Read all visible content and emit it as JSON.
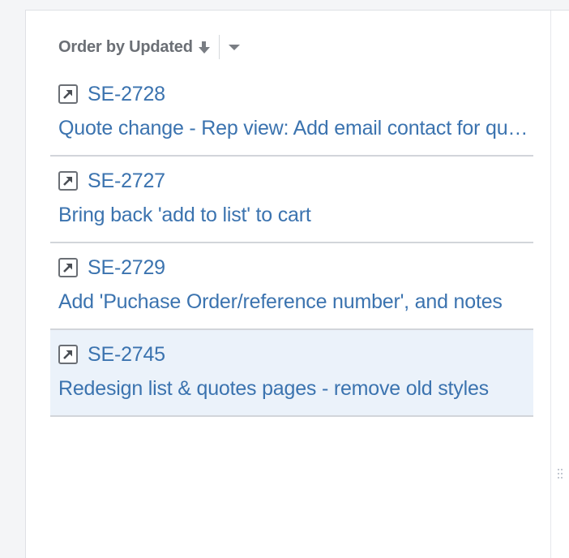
{
  "order": {
    "label": "Order by Updated",
    "sort_direction_icon": "arrow-down-icon",
    "menu_icon": "caret-down-icon"
  },
  "issues": [
    {
      "key": "SE-2728",
      "summary": "Quote change - Rep view: Add email contact for quotes",
      "selected": false,
      "type_icon": "sub-task-arrow-icon"
    },
    {
      "key": "SE-2727",
      "summary": "Bring back 'add to list' to cart",
      "selected": false,
      "type_icon": "sub-task-arrow-icon"
    },
    {
      "key": "SE-2729",
      "summary": "Add 'Puchase Order/reference number', and notes",
      "selected": false,
      "type_icon": "sub-task-arrow-icon"
    },
    {
      "key": "SE-2745",
      "summary": "Redesign list & quotes pages - remove old styles",
      "selected": true,
      "type_icon": "sub-task-arrow-icon"
    }
  ],
  "colors": {
    "link": "#3b73af",
    "selected_row": "#ebf2fa",
    "muted_text": "#6b6f75"
  }
}
